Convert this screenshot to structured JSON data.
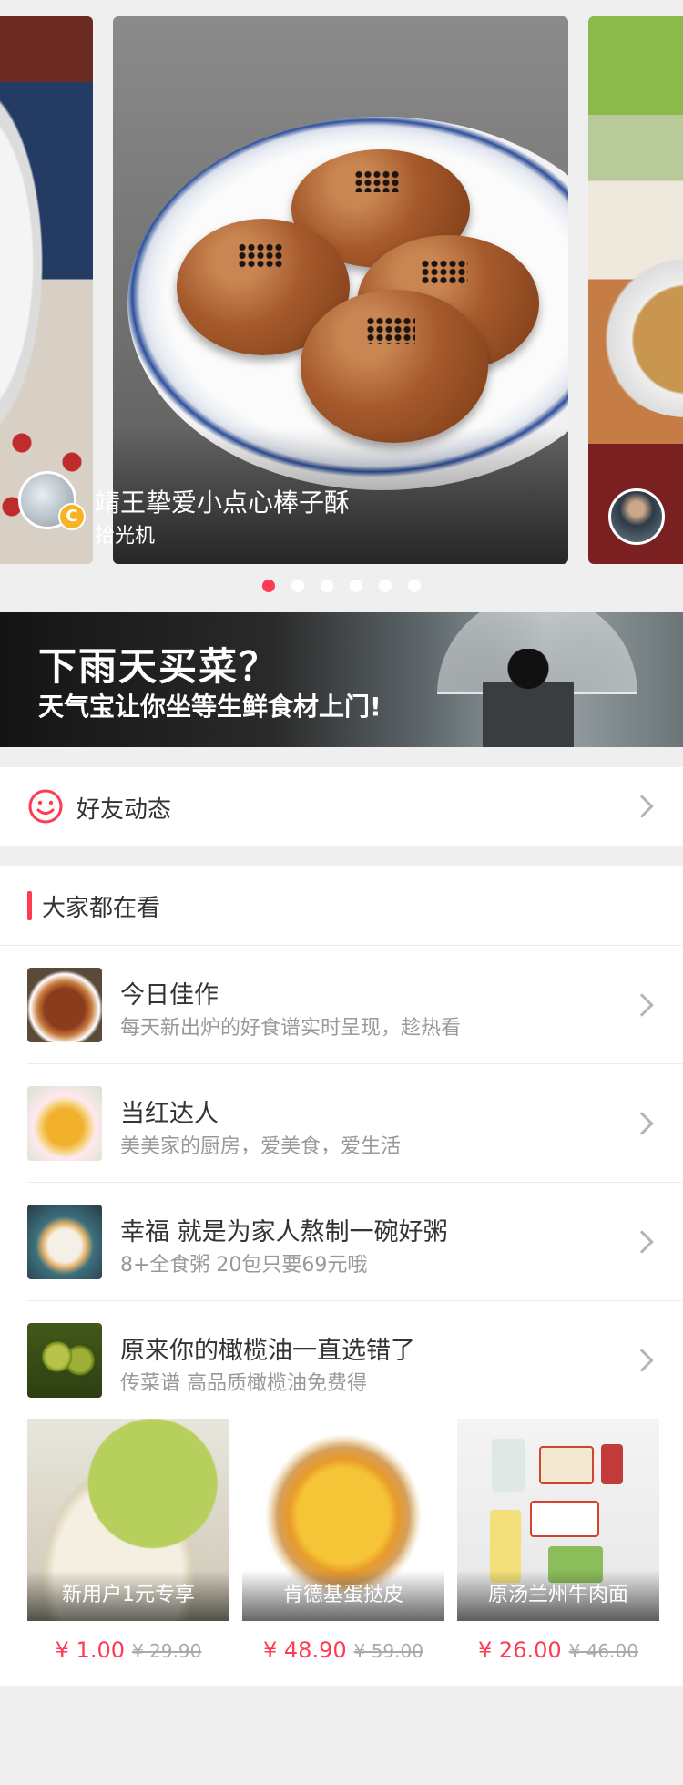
{
  "carousel": {
    "recipe_title": "靖王挚爱小点心棒子酥",
    "author": "拾光机",
    "author_badge": "C",
    "active_slide": 1,
    "slide_count": 6
  },
  "banner": {
    "title": "下雨天买菜？",
    "subtitle": "天气宝让你坐等生鲜食材上门!"
  },
  "friends": {
    "label": "好友动态",
    "icon": "smile-icon"
  },
  "popular": {
    "title": "大家都在看",
    "items": [
      {
        "title": "今日佳作",
        "subtitle": "每天新出炉的好食谱实时呈现，趁热看"
      },
      {
        "title": "当红达人",
        "subtitle": "美美家的厨房，爱美食，爱生活"
      },
      {
        "title": "幸福 就是为家人熬制一碗好粥",
        "subtitle": "8+全食粥 20包只要69元哦"
      },
      {
        "title": "原来你的橄榄油一直选错了",
        "subtitle": "传菜谱 高品质橄榄油免费得"
      }
    ],
    "products": [
      {
        "name": "新用户1元专享",
        "price": "¥ 1.00",
        "old_price": "¥ 29.90"
      },
      {
        "name": "肯德基蛋挞皮",
        "price": "¥ 48.90",
        "old_price": "¥ 59.00"
      },
      {
        "name": "原汤兰州牛肉面",
        "price": "¥ 26.00",
        "old_price": "¥ 46.00"
      }
    ]
  },
  "colors": {
    "accent": "#ff3a52",
    "background": "#efefef",
    "secondary_text": "#999999"
  }
}
